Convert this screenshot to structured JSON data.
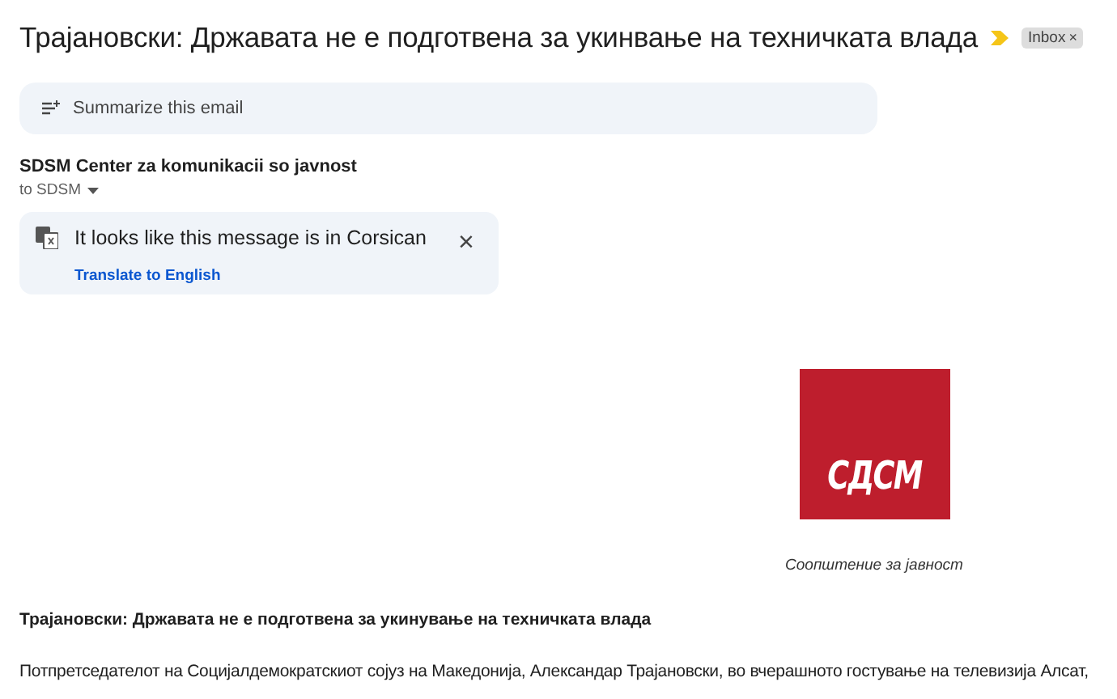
{
  "subject": "Трајановски: Државата не е подготвена за укинвање на техничката влада",
  "label": {
    "text": "Inbox",
    "remove": "×"
  },
  "summarize": {
    "label": "Summarize this email"
  },
  "sender": {
    "name": "SDSM Center za komunikacii so javnost",
    "to": "to SDSM"
  },
  "translate_banner": {
    "message": "It looks like this message is in Corsican",
    "action": "Translate to English",
    "close": "×"
  },
  "body": {
    "logo_text": "СДСМ",
    "caption": "Соопштение за јавност",
    "heading": "Трајановски: Државата не е подготвена за укинување на техничката влада",
    "paragraph": "Потпретседателот на Социјалдемократскиот сојуз на Македонија, Александар Трајановски, во вчерашното гостување на телевизија Алсат,"
  }
}
